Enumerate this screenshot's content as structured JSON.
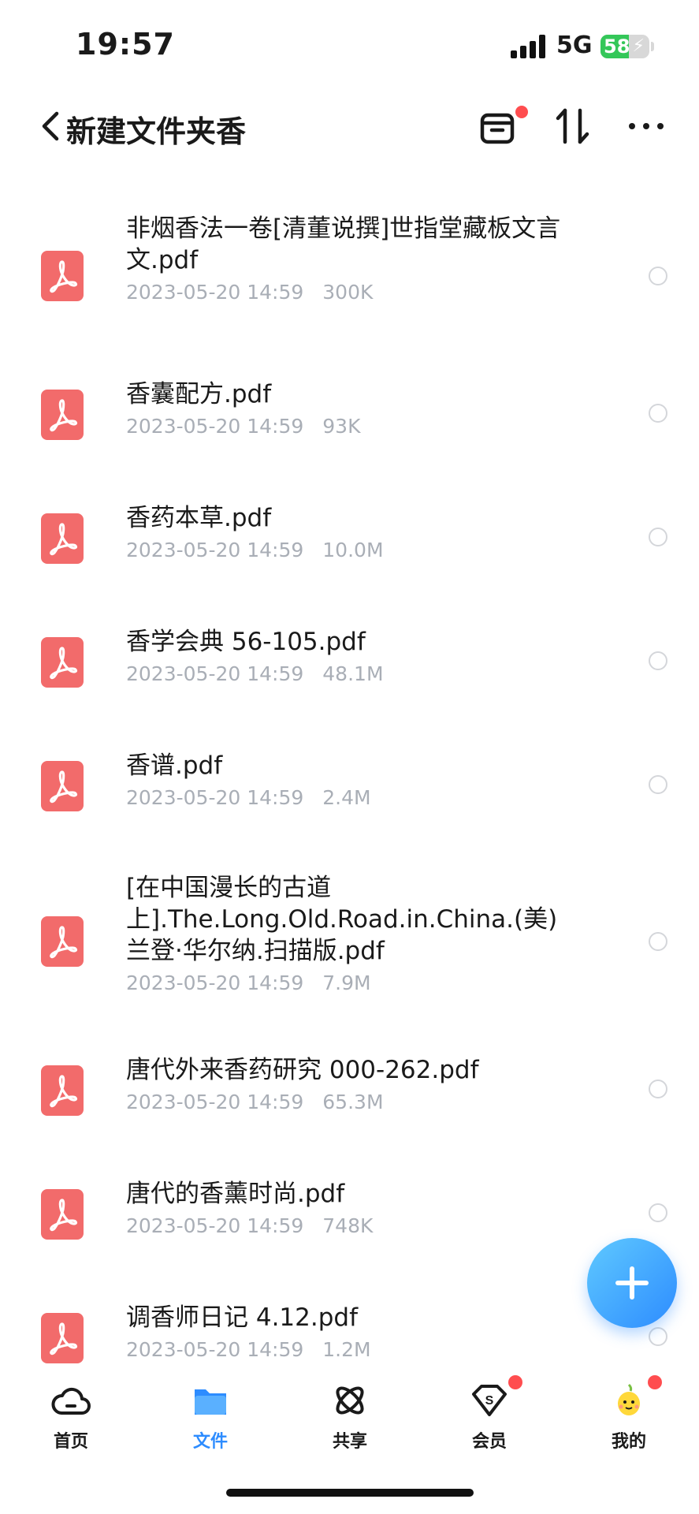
{
  "status_bar": {
    "time": "19:57",
    "network": "5G",
    "battery": "58",
    "battery_level": 0.58
  },
  "header": {
    "title": "新建文件夹香"
  },
  "files": [
    {
      "name": "非烟香法一卷[清董说撰]世指堂藏板文言文.pdf",
      "date": "2023-05-20 14:59",
      "size": "300K"
    },
    {
      "name": "香囊配方.pdf",
      "date": "2023-05-20 14:59",
      "size": "93K"
    },
    {
      "name": "香药本草.pdf",
      "date": "2023-05-20 14:59",
      "size": "10.0M"
    },
    {
      "name": "香学会典 56-105.pdf",
      "date": "2023-05-20 14:59",
      "size": "48.1M"
    },
    {
      "name": "香谱.pdf",
      "date": "2023-05-20 14:59",
      "size": "2.4M"
    },
    {
      "name": "[在中国漫长的古道上].The.Long.Old.Road.in.China.(美)兰登·华尔纳.扫描版.pdf",
      "date": "2023-05-20 14:59",
      "size": "7.9M"
    },
    {
      "name": "唐代外来香药研究 000-262.pdf",
      "date": "2023-05-20 14:59",
      "size": "65.3M"
    },
    {
      "name": "唐代的香薰时尚.pdf",
      "date": "2023-05-20 14:59",
      "size": "748K"
    },
    {
      "name": "调香师日记 4.12.pdf",
      "date": "2023-05-20 14:59",
      "size": "1.2M"
    }
  ],
  "tabs": [
    {
      "label": "首页",
      "icon": "cloud-icon"
    },
    {
      "label": "文件",
      "icon": "folder-icon"
    },
    {
      "label": "共享",
      "icon": "atom-icon"
    },
    {
      "label": "会员",
      "icon": "vip-diamond-icon"
    },
    {
      "label": "我的",
      "icon": "mascot-avatar-icon"
    }
  ],
  "colors": {
    "accent": "#2d8cff",
    "pdf_icon": "#f26b6b",
    "meta_text": "#a9aeb6",
    "badge": "#ff4d4f",
    "battery": "#34c759"
  }
}
